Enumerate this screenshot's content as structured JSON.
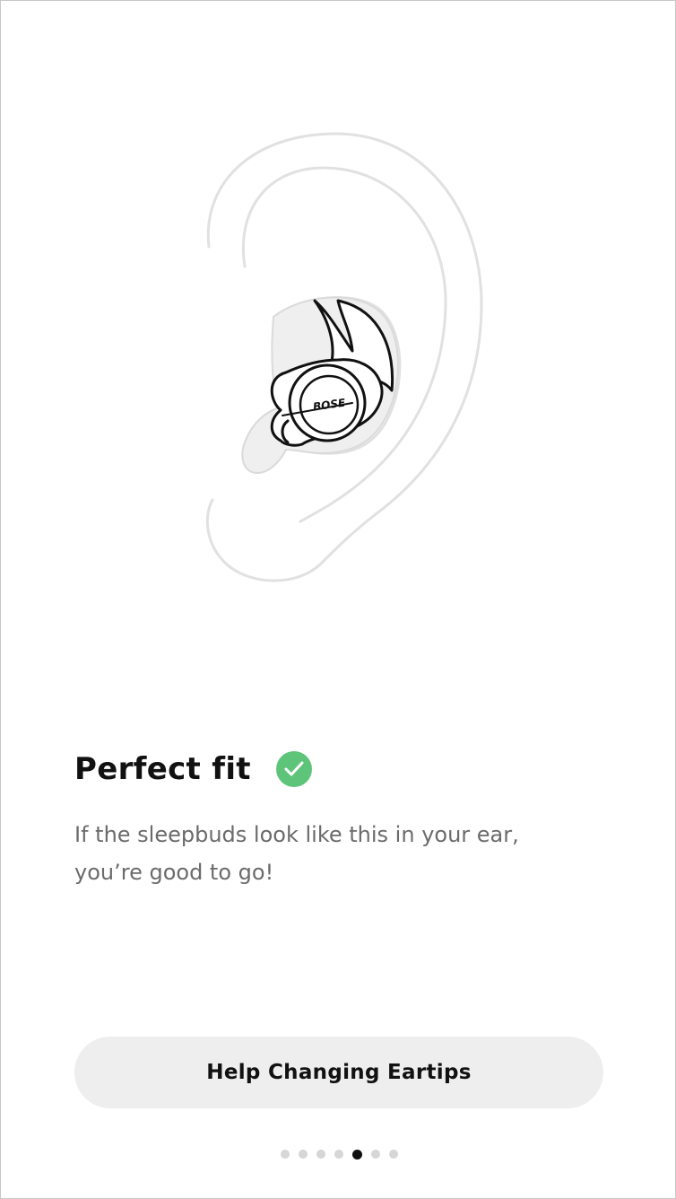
{
  "illustration": {
    "icon": "ear-with-sleepbud",
    "logo_text": "BOSE"
  },
  "content": {
    "title": "Perfect fit",
    "status_icon": "check-circle-icon",
    "status_color": "#5ec47a",
    "description": "If the sleepbuds look like this in your ear, you’re good to go!"
  },
  "actions": {
    "help_button_label": "Help Changing Eartips"
  },
  "pager": {
    "total_pages": 7,
    "current_page": 5
  }
}
